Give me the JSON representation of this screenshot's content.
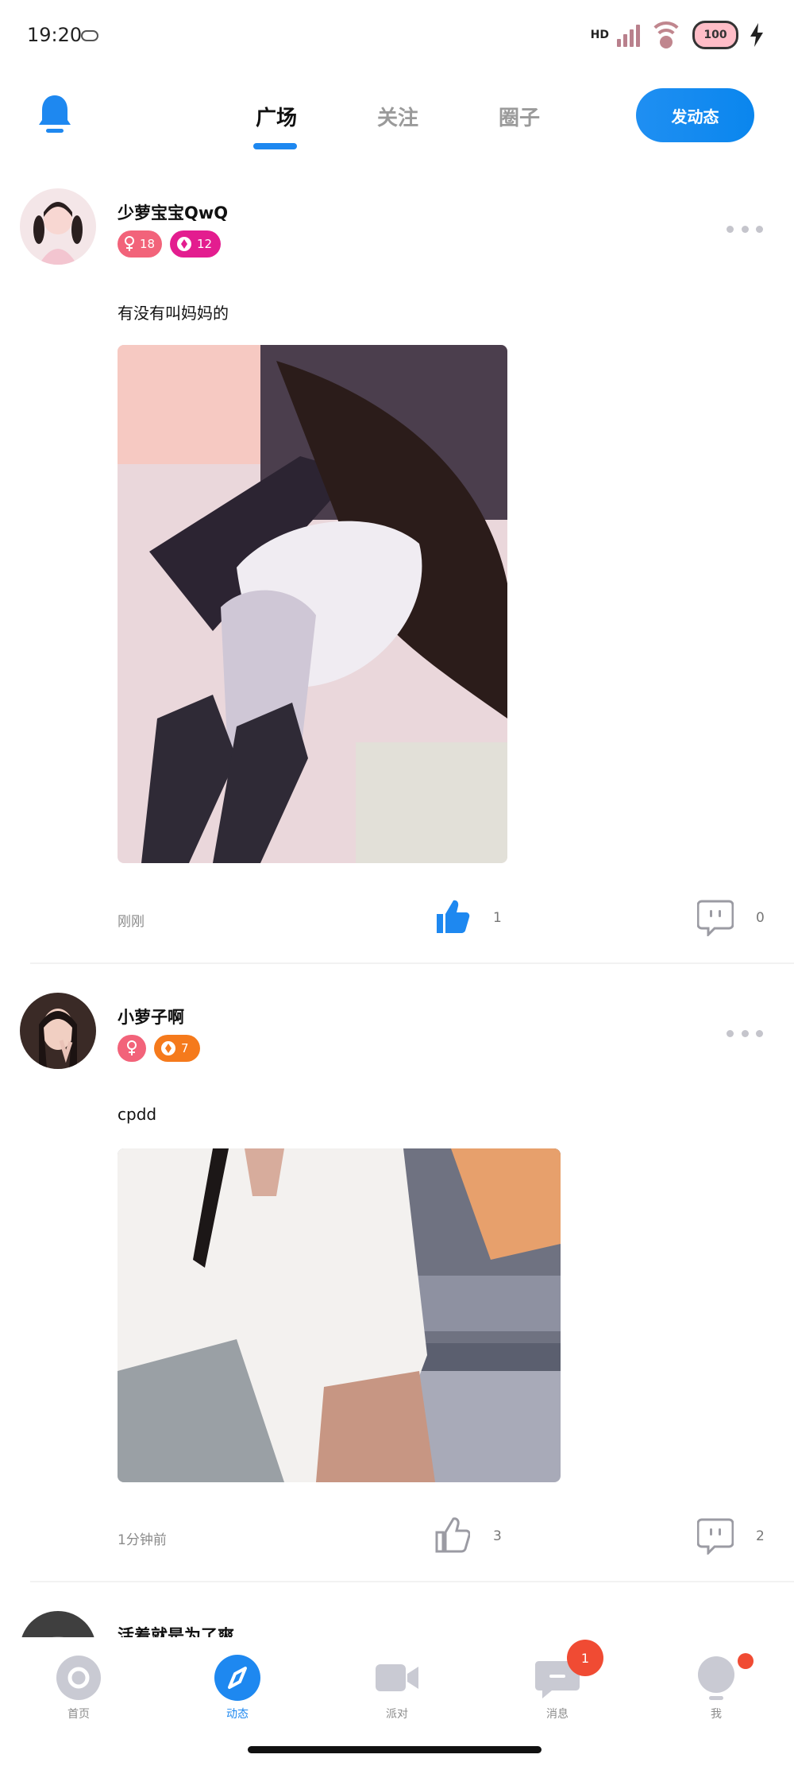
{
  "status_bar": {
    "time": "19:20",
    "network_badge": "HD",
    "battery_level": "100"
  },
  "header": {
    "tabs": [
      {
        "label": "广场",
        "active": true
      },
      {
        "label": "关注",
        "active": false
      },
      {
        "label": "圈子",
        "active": false
      }
    ],
    "post_button_label": "发动态"
  },
  "posts": [
    {
      "username": "少萝宝宝QwQ",
      "gender_icon": "female-icon",
      "age": "18",
      "level": "12",
      "text": "有没有叫妈妈的",
      "time": "刚刚",
      "likes": "1",
      "liked": true,
      "comments": "0"
    },
    {
      "username": "小萝子啊",
      "gender_icon": "female-icon",
      "age": "",
      "level": "7",
      "text": "cpdd",
      "time": "1分钟前",
      "likes": "3",
      "liked": false,
      "comments": "2"
    },
    {
      "username": "活着就是为了爽"
    }
  ],
  "bottom_nav": [
    {
      "label": "首页",
      "icon": "home-icon",
      "active": false
    },
    {
      "label": "动态",
      "icon": "compass-icon",
      "active": true
    },
    {
      "label": "派对",
      "icon": "video-icon",
      "active": false
    },
    {
      "label": "消息",
      "icon": "message-icon",
      "active": false,
      "badge": "1"
    },
    {
      "label": "我",
      "icon": "profile-icon",
      "active": false
    }
  ],
  "colors": {
    "accent": "#1e88f0",
    "badge_red": "#f04b33",
    "female_badge": "#f2637a",
    "level_badge_pink": "#e31d8f",
    "level_badge_orange": "#f57a1c"
  }
}
